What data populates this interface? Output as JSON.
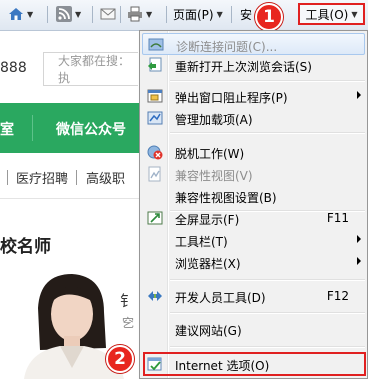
{
  "cmdbar": {
    "page_label": "页面(P)",
    "safety_label": "安",
    "tools_label": "工具(O)"
  },
  "markers": {
    "first": "1",
    "second": "2"
  },
  "page": {
    "phone_fragment": "888",
    "search_placeholder": "大家都在搜：执",
    "green_nav": [
      "室",
      "微信公众号"
    ],
    "links": [
      "医疗招聘",
      "高级职"
    ],
    "headline": "校名师",
    "edge_chars": [
      "钅",
      "穵"
    ]
  },
  "menu": {
    "items": [
      {
        "label": "诊断连接问题(C)...",
        "disabled": true,
        "highlight": true,
        "icon": "diagnose-connection-icon"
      },
      {
        "label": "重新打开上次浏览会话(S)",
        "icon": "reopen-session-icon"
      },
      {
        "label": "弹出窗口阻止程序(P)",
        "submenu": true,
        "icon": "popup-blocker-icon"
      },
      {
        "label": "管理加载项(A)",
        "icon": "manage-addons-icon"
      },
      {
        "label": "脱机工作(W)",
        "icon": "work-offline-icon"
      },
      {
        "label": "兼容性视图(V)",
        "disabled": true,
        "icon": "compat-view-icon"
      },
      {
        "label": "兼容性视图设置(B)"
      },
      {
        "label": "全屏显示(F)",
        "shortcut": "F11",
        "icon": "fullscreen-icon"
      },
      {
        "label": "工具栏(T)",
        "submenu": true
      },
      {
        "label": "浏览器栏(X)",
        "submenu": true
      },
      {
        "label": "开发人员工具(D)",
        "shortcut": "F12",
        "icon": "developer-tools-icon"
      },
      {
        "label": "建议网站(G)"
      },
      {
        "label": "Internet 选项(O)",
        "icon": "internet-options-icon"
      }
    ]
  },
  "colors": {
    "annotation_red": "#e02020",
    "menu_bg": "#f1f1f1",
    "green_nav": "#2aa860"
  }
}
